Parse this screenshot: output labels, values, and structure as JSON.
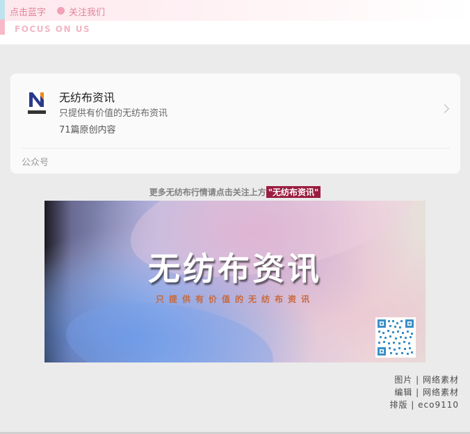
{
  "header": {
    "click_text": "点击蓝字",
    "follow_text": "关注我们",
    "focus_text": "FOCUS ON US",
    "colors": {
      "accent_pink": "#e2839a",
      "accent_blue": "#bde3ee"
    }
  },
  "account_card": {
    "name": "无纺布资讯",
    "description": "只提供有价值的无纺布资讯",
    "original_count": "71篇原创内容",
    "type_label": "公众号",
    "logo_icon": "nonwoven-logo-icon",
    "chevron_icon": "chevron-right-icon"
  },
  "promo": {
    "prefix": "更多无纺布行情请点击关注上方",
    "highlight": "\"无纺布资讯\"",
    "highlight_color": "#9a1d3f"
  },
  "banner": {
    "title": "无纺布资讯",
    "subtitle": "只提供有价值的无纺布资讯",
    "qr_icon": "qr-code-icon"
  },
  "credits": [
    "图片 | 网络素材",
    "编辑 | 网络素材",
    "排版 | eco9110"
  ]
}
